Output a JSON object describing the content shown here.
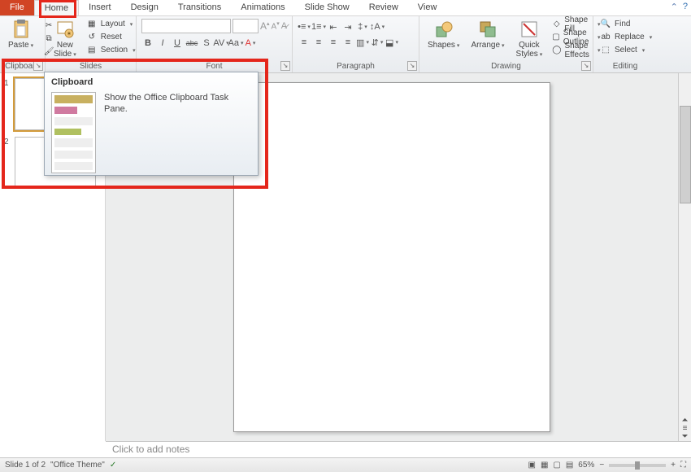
{
  "tabs": {
    "file": "File",
    "home": "Home",
    "insert": "Insert",
    "design": "Design",
    "transitions": "Transitions",
    "animations": "Animations",
    "slideshow": "Slide Show",
    "review": "Review",
    "view": "View"
  },
  "ribbon": {
    "clipboard": {
      "label": "Clipboard",
      "paste": "Paste"
    },
    "slides": {
      "label": "Slides",
      "new_slide": "New\nSlide",
      "layout": "Layout",
      "reset": "Reset",
      "section": "Section"
    },
    "font": {
      "label": "Font",
      "bold": "B",
      "italic": "I",
      "underline": "U",
      "strike": "abc",
      "shadow": "S",
      "spacing": "AV",
      "case": "Aa",
      "grow": "A",
      "shrink": "A",
      "clear": "A"
    },
    "paragraph": {
      "label": "Paragraph"
    },
    "drawing": {
      "label": "Drawing",
      "shapes": "Shapes",
      "arrange": "Arrange",
      "quick_styles": "Quick\nStyles",
      "shape_fill": "Shape Fill",
      "shape_outline": "Shape Outline",
      "shape_effects": "Shape Effects"
    },
    "editing": {
      "label": "Editing",
      "find": "Find",
      "replace": "Replace",
      "select": "Select"
    }
  },
  "tooltip": {
    "title": "Clipboard",
    "text": "Show the Office Clipboard Task Pane."
  },
  "thumbs": {
    "n1": "1",
    "n2": "2"
  },
  "notes": {
    "placeholder": "Click to add notes"
  },
  "status": {
    "slide": "Slide 1 of 2",
    "theme": "\"Office Theme\"",
    "zoom": "65%",
    "minus": "−",
    "plus": "+"
  }
}
